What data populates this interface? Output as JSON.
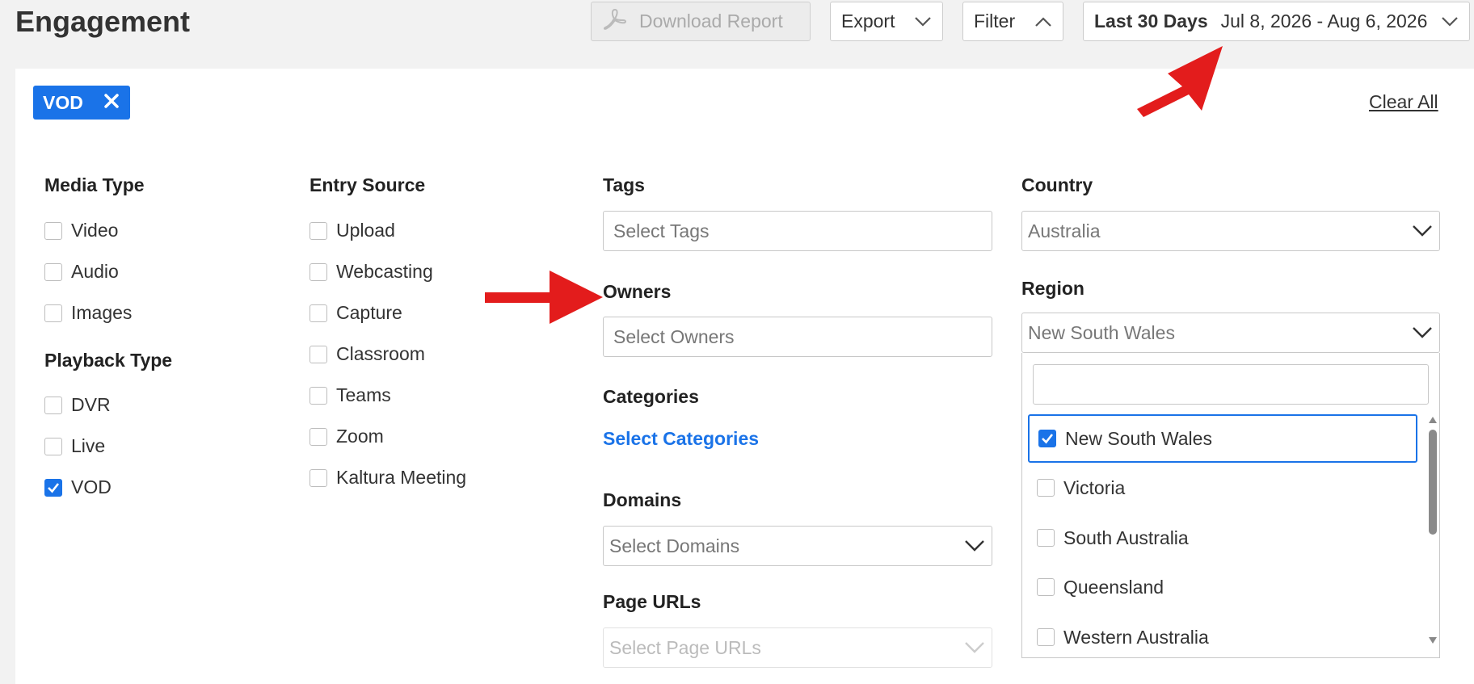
{
  "header": {
    "title": "Engagement",
    "download_label": "Download Report",
    "export_label": "Export",
    "filter_label": "Filter",
    "date_preset": "Last 30 Days",
    "date_range": "Jul 8, 2026 - Aug 6, 2026"
  },
  "chips": {
    "vod": "VOD",
    "clear_all": "Clear All"
  },
  "media_type": {
    "title": "Media Type",
    "items": [
      "Video",
      "Audio",
      "Images"
    ]
  },
  "playback_type": {
    "title": "Playback Type",
    "items": [
      "DVR",
      "Live",
      "VOD"
    ]
  },
  "entry_source": {
    "title": "Entry Source",
    "items": [
      "Upload",
      "Webcasting",
      "Capture",
      "Classroom",
      "Teams",
      "Zoom",
      "Kaltura Meeting"
    ]
  },
  "tags": {
    "title": "Tags",
    "placeholder": "Select Tags"
  },
  "owners": {
    "title": "Owners",
    "placeholder": "Select Owners"
  },
  "categories": {
    "title": "Categories",
    "link": "Select Categories"
  },
  "domains": {
    "title": "Domains",
    "placeholder": "Select Domains"
  },
  "page_urls": {
    "title": "Page URLs",
    "placeholder": "Select Page URLs"
  },
  "country": {
    "title": "Country",
    "value": "Australia"
  },
  "region": {
    "title": "Region",
    "value": "New South Wales",
    "options": [
      "New South Wales",
      "Victoria",
      "South Australia",
      "Queensland",
      "Western Australia"
    ]
  },
  "colors": {
    "accent": "#1a73e8",
    "annotation": "#e31c1c"
  }
}
